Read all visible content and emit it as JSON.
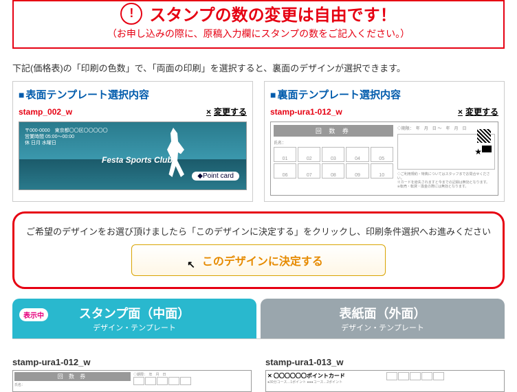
{
  "notice": {
    "title": "スタンプの数の変更は自由です！",
    "sub": "（お申し込みの際に、原稿入力欄にスタンプの数をご記入ください。）"
  },
  "lead": "下記(価格表)の「印刷の色数」で、「両面の印刷」を選択すると、裏面のデザインが選択できます。",
  "front_sel": {
    "head": "表面テンプレート選択内容",
    "id": "stamp_002_w",
    "change": "変更する",
    "club": "Festa Sports Club",
    "pointcard": "◆Point card"
  },
  "back_sel": {
    "head": "裏面テンプレート選択内容",
    "id": "stamp-ura1-012_w",
    "change": "変更する",
    "bar": "回 数 券",
    "cells": [
      "01",
      "02",
      "03",
      "04",
      "05",
      "06",
      "07",
      "08",
      "09",
      "10"
    ]
  },
  "decide": {
    "text": "ご希望のデザインをお選び頂けましたら「このデザインに決定する」をクリックし、印刷条件選択へお進みください",
    "btn": "このデザインに決定する"
  },
  "tabs": {
    "active": {
      "badge": "表示中",
      "title": "スタンプ面（中面）",
      "sub": "デザイン・テンプレート"
    },
    "inactive": {
      "title": "表紙面（外面）",
      "sub": "デザイン・テンプレート"
    }
  },
  "tpl": {
    "a": {
      "id": "stamp-ura1-012_w",
      "bar": "回 数 券"
    },
    "b": {
      "id": "stamp-ura1-013_w",
      "bar": "〇〇〇〇〇〇ポイントカード"
    }
  }
}
